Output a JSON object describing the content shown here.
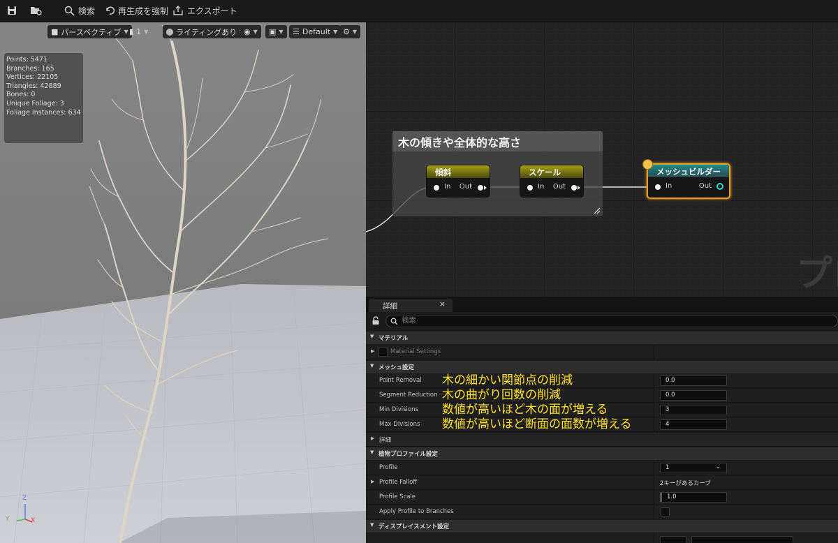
{
  "toolbar": {
    "search": "検索",
    "force_regen": "再生成を強制",
    "export": "エクスポート"
  },
  "viewport": {
    "perspective": "パースペクティブ",
    "count": "1",
    "lighting": "ライティングあり",
    "scalability": "Default",
    "stats": [
      "Points: 5471",
      "Branches: 165",
      "Vertices: 22105",
      "Triangles: 42889",
      "Bones: 0",
      "Unique Foliage: 3",
      "Foliage Instances: 634"
    ],
    "gizmo": {
      "z": "Z",
      "y": "Y",
      "x": "X"
    }
  },
  "graph": {
    "comment_title": "木の傾きや全体的な高さ",
    "nodes": [
      {
        "title": "傾斜",
        "in": "In",
        "out": "Out"
      },
      {
        "title": "スケール",
        "in": "In",
        "out": "Out"
      },
      {
        "title": "メッシュビルダー",
        "in": "In",
        "out": "Out"
      }
    ],
    "watermark": "プロ"
  },
  "details": {
    "tab": "詳細",
    "close": "×",
    "search_placeholder": "検索",
    "categories": {
      "material": "マテリアル",
      "mesh": "メッシュ設定",
      "detail": "詳細",
      "profile": "植物プロファイル設定",
      "displacement": "ディスプレイスメント設定"
    },
    "material_settings": "Material Settings",
    "mesh_props": [
      {
        "name": "Point Removal",
        "value": "0.0",
        "note": "木の細かい関節点の削減"
      },
      {
        "name": "Segment Reduction",
        "value": "0.0",
        "note": "木の曲がり回数の削減"
      },
      {
        "name": "Min Divisions",
        "value": "3",
        "note": "数値が高いほど木の面が増える"
      },
      {
        "name": "Max Divisions",
        "value": "4",
        "note": "数値が高いほど断面の面数が増える"
      }
    ],
    "profile_props": {
      "profile": {
        "name": "Profile",
        "value": "1"
      },
      "falloff": {
        "name": "Profile Falloff",
        "value": "2キーがあるカーブ"
      },
      "scale": {
        "name": "Profile Scale",
        "value": "1.0"
      },
      "apply": {
        "name": "Apply Profile to Branches"
      }
    }
  }
}
